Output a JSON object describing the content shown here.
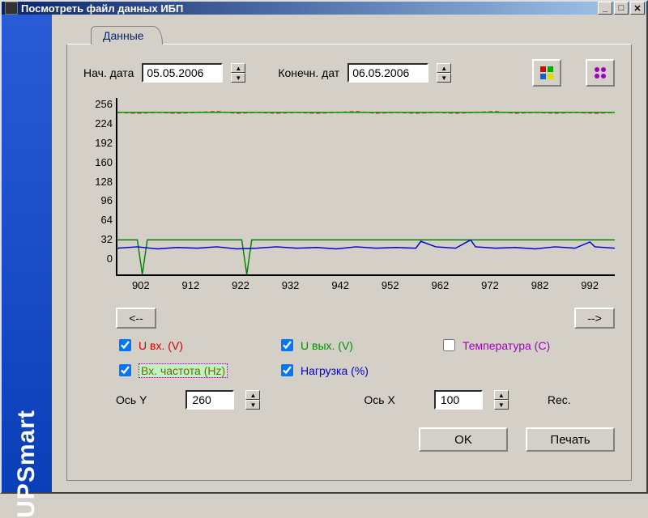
{
  "window": {
    "title": "Посмотреть файл данных ИБП"
  },
  "sidebar": {
    "brand": "UPSmart"
  },
  "tab": {
    "label": "Данные"
  },
  "dates": {
    "start_label": "Нач. дата",
    "start_value": "05.05.2006",
    "end_label": "Конечн. дат",
    "end_value": "06.05.2006"
  },
  "nav": {
    "prev": "<--",
    "next": "-->"
  },
  "series": {
    "uin": {
      "label": "U вх. (V)",
      "checked": true,
      "color": "#d00000"
    },
    "uout": {
      "label": "U вых. (V)",
      "checked": true,
      "color": "#009000"
    },
    "temp": {
      "label": "Температура (C)",
      "checked": false,
      "color": "#a000c0"
    },
    "freq": {
      "label": "Вх. частота (Hz)",
      "checked": true,
      "color": "#6b6b00"
    },
    "load": {
      "label": "Нагрузка (%)",
      "checked": true,
      "color": "#0000d0"
    }
  },
  "axes": {
    "y_label": "Ось Y",
    "y_value": "260",
    "x_label": "Ось X",
    "x_value": "100",
    "rec_label": "Rec."
  },
  "buttons": {
    "ok": "OK",
    "print": "Печать"
  },
  "chart_data": {
    "type": "line",
    "xlabel": "",
    "ylabel": "",
    "ylim": [
      0,
      256
    ],
    "xlim": [
      898,
      998
    ],
    "y_ticks": [
      0,
      32,
      64,
      96,
      128,
      160,
      192,
      224,
      256
    ],
    "x_ticks": [
      902,
      912,
      922,
      932,
      942,
      952,
      962,
      972,
      982,
      992
    ],
    "series": [
      {
        "name": "U вх. (V)",
        "color": "#d00000",
        "x": [
          898,
          902,
          906,
          910,
          914,
          918,
          922,
          926,
          930,
          934,
          938,
          942,
          946,
          950,
          954,
          958,
          962,
          966,
          970,
          974,
          978,
          982,
          986,
          990,
          994,
          998
        ],
        "values": [
          235,
          234,
          235,
          234,
          235,
          236,
          234,
          235,
          234,
          235,
          234,
          235,
          236,
          234,
          235,
          234,
          235,
          234,
          235,
          236,
          234,
          235,
          234,
          235,
          234,
          235
        ]
      },
      {
        "name": "U вых. (V)",
        "color": "#00a000",
        "x": [
          898,
          902,
          906,
          910,
          914,
          918,
          922,
          926,
          930,
          934,
          938,
          942,
          946,
          950,
          954,
          958,
          962,
          966,
          970,
          974,
          978,
          982,
          986,
          990,
          994,
          998
        ],
        "values": [
          235,
          235,
          235,
          235,
          235,
          235,
          235,
          235,
          235,
          235,
          235,
          235,
          235,
          235,
          235,
          235,
          235,
          235,
          235,
          235,
          235,
          235,
          235,
          235,
          235,
          235
        ]
      },
      {
        "name": "Вх. частота (Hz)",
        "color": "#008000",
        "x": [
          898,
          902,
          903,
          904,
          910,
          918,
          923,
          924,
          925,
          932,
          942,
          952,
          962,
          972,
          982,
          992,
          998
        ],
        "values": [
          50,
          50,
          0,
          50,
          50,
          50,
          50,
          0,
          50,
          50,
          50,
          50,
          50,
          50,
          50,
          50,
          50
        ]
      },
      {
        "name": "Нагрузка (%)",
        "color": "#0000d0",
        "x": [
          898,
          902,
          906,
          910,
          914,
          918,
          922,
          926,
          930,
          934,
          938,
          942,
          946,
          950,
          954,
          958,
          959,
          962,
          966,
          969,
          970,
          974,
          978,
          982,
          986,
          990,
          993,
          994,
          998
        ],
        "values": [
          38,
          40,
          37,
          39,
          38,
          40,
          37,
          38,
          40,
          38,
          39,
          37,
          40,
          38,
          39,
          38,
          48,
          40,
          38,
          50,
          40,
          38,
          39,
          37,
          40,
          38,
          47,
          40,
          38
        ]
      }
    ]
  }
}
